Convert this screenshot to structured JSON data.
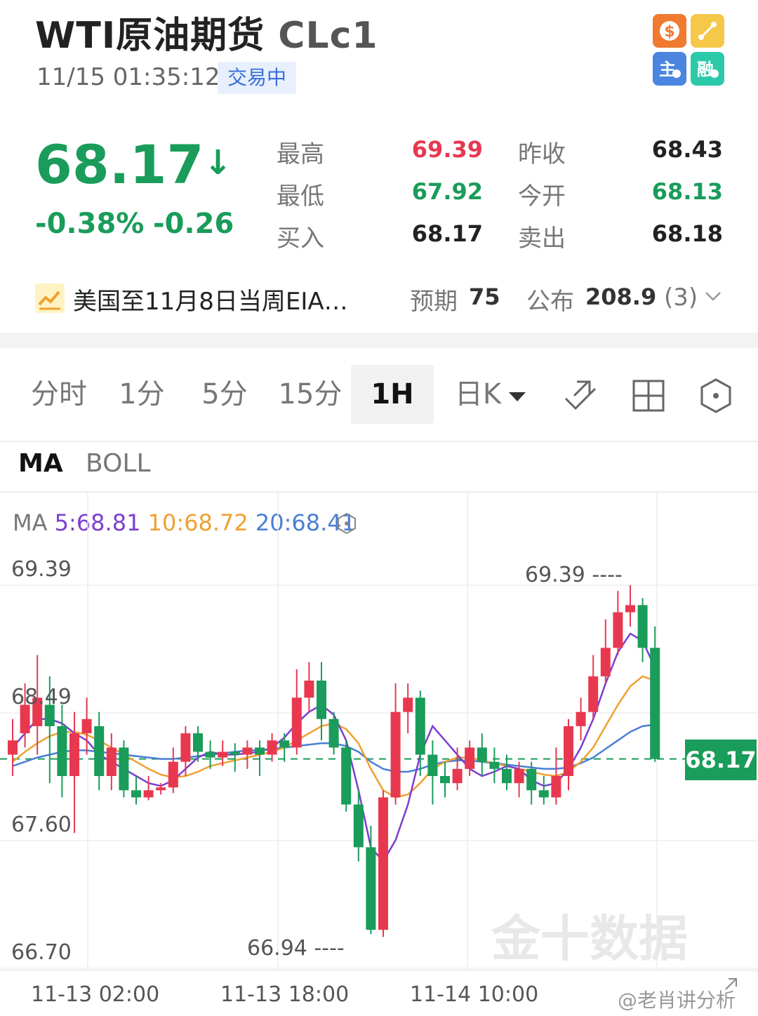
{
  "header": {
    "title": "WTI原油期货",
    "code": "CLc1",
    "time": "11/15 01:35:12",
    "status": "交易中"
  },
  "header_icons": [
    "dollar-icon",
    "link-icon",
    "main-icon",
    "finance-icon"
  ],
  "quote": {
    "price": "68.17",
    "pct": "-0.38%",
    "change": "-0.26",
    "high_label": "最高",
    "high": "69.39",
    "prev_label": "昨收",
    "prev": "68.43",
    "low_label": "最低",
    "low": "67.92",
    "open_label": "今开",
    "open": "68.13",
    "bid_label": "买入",
    "bid": "68.17",
    "ask_label": "卖出",
    "ask": "68.18"
  },
  "news": {
    "text": "美国至11月8日当周EIA…",
    "expect_label": "预期",
    "expect": "75",
    "actual_label": "公布",
    "actual": "208.9",
    "count": "(3)"
  },
  "tabs": [
    "分时",
    "1分",
    "5分",
    "15分",
    "1H",
    "日K"
  ],
  "active_tab": "1H",
  "indicator_tabs": [
    "MA",
    "BOLL"
  ],
  "ma_legend": {
    "prefix": "MA",
    "ma5": "5:68.81",
    "ma10": "10:68.72",
    "ma20": "20:68.41"
  },
  "colors": {
    "up": "#e8384f",
    "down": "#1a9c5a",
    "ma5": "#7b3fd0",
    "ma10": "#f0a030",
    "ma20": "#4a7fd4"
  },
  "chart_data": {
    "type": "candlestick",
    "y_ticks": [
      "69.39",
      "68.49",
      "67.60",
      "66.70"
    ],
    "ylim": [
      66.7,
      69.39
    ],
    "x_ticks": [
      "11-13 02:00",
      "11-13 18:00",
      "11-14 10:00"
    ],
    "high_marker": "69.39",
    "low_marker": "66.94",
    "current_price": "68.17",
    "candles": [
      [
        68.2,
        68.3,
        68.45,
        68.05
      ],
      [
        68.35,
        68.55,
        68.7,
        68.25
      ],
      [
        68.4,
        68.6,
        68.9,
        68.2
      ],
      [
        68.55,
        68.4,
        68.75,
        68.0
      ],
      [
        68.4,
        68.05,
        68.55,
        67.9
      ],
      [
        68.05,
        68.35,
        68.5,
        67.65
      ],
      [
        68.35,
        68.45,
        68.6,
        68.2
      ],
      [
        68.4,
        68.05,
        68.5,
        67.95
      ],
      [
        68.05,
        68.25,
        68.35,
        67.95
      ],
      [
        68.25,
        67.95,
        68.3,
        67.9
      ],
      [
        67.95,
        67.9,
        68.05,
        67.85
      ],
      [
        67.9,
        67.95,
        68.05,
        67.88
      ],
      [
        67.95,
        67.97,
        68.0,
        67.92
      ],
      [
        67.97,
        68.15,
        68.25,
        67.93
      ],
      [
        68.15,
        68.35,
        68.4,
        68.05
      ],
      [
        68.35,
        68.22,
        68.4,
        68.15
      ],
      [
        68.22,
        68.18,
        68.3,
        68.1
      ],
      [
        68.18,
        68.22,
        68.3,
        68.12
      ],
      [
        68.22,
        68.2,
        68.28,
        68.08
      ],
      [
        68.2,
        68.25,
        68.3,
        68.1
      ],
      [
        68.25,
        68.2,
        68.3,
        68.05
      ],
      [
        68.2,
        68.3,
        68.35,
        68.15
      ],
      [
        68.3,
        68.25,
        68.35,
        68.15
      ],
      [
        68.25,
        68.6,
        68.8,
        68.2
      ],
      [
        68.6,
        68.72,
        68.85,
        68.5
      ],
      [
        68.72,
        68.45,
        68.85,
        68.3
      ],
      [
        68.45,
        68.25,
        68.5,
        68.2
      ],
      [
        68.25,
        67.85,
        68.3,
        67.8
      ],
      [
        67.85,
        67.55,
        67.95,
        67.45
      ],
      [
        67.55,
        66.97,
        67.7,
        66.94
      ],
      [
        66.97,
        67.9,
        67.95,
        66.92
      ],
      [
        67.9,
        68.5,
        68.7,
        67.85
      ],
      [
        68.5,
        68.6,
        68.7,
        68.35
      ],
      [
        68.6,
        68.2,
        68.65,
        68.05
      ],
      [
        68.2,
        68.05,
        68.3,
        67.85
      ],
      [
        68.05,
        68.0,
        68.15,
        67.9
      ],
      [
        68.0,
        68.1,
        68.25,
        67.95
      ],
      [
        68.1,
        68.25,
        68.3,
        68.05
      ],
      [
        68.25,
        68.15,
        68.35,
        68.05
      ],
      [
        68.15,
        68.1,
        68.25,
        68.0
      ],
      [
        68.1,
        68.0,
        68.2,
        67.95
      ],
      [
        68.0,
        68.1,
        68.15,
        67.9
      ],
      [
        68.1,
        67.95,
        68.15,
        67.85
      ],
      [
        67.95,
        67.9,
        68.05,
        67.85
      ],
      [
        67.9,
        68.05,
        68.25,
        67.85
      ],
      [
        68.05,
        68.4,
        68.45,
        67.95
      ],
      [
        68.4,
        68.5,
        68.6,
        68.3
      ],
      [
        68.5,
        68.75,
        68.9,
        68.45
      ],
      [
        68.75,
        68.95,
        69.15,
        68.7
      ],
      [
        68.95,
        69.2,
        69.35,
        68.9
      ],
      [
        69.2,
        69.25,
        69.39,
        69.1
      ],
      [
        69.25,
        68.95,
        69.3,
        68.85
      ],
      [
        68.95,
        68.17,
        69.1,
        68.15
      ]
    ],
    "ma5": [
      68.25,
      68.35,
      68.45,
      68.45,
      68.42,
      68.35,
      68.3,
      68.2,
      68.15,
      68.1,
      68.05,
      68.0,
      67.98,
      68.02,
      68.1,
      68.18,
      68.22,
      68.2,
      68.2,
      68.21,
      68.22,
      68.25,
      68.32,
      68.42,
      68.5,
      68.55,
      68.48,
      68.3,
      67.95,
      67.55,
      67.45,
      67.6,
      67.85,
      68.2,
      68.4,
      68.3,
      68.2,
      68.1,
      68.05,
      68.08,
      68.12,
      68.1,
      68.02,
      67.98,
      68.0,
      68.1,
      68.25,
      68.45,
      68.7,
      68.92,
      69.05,
      69.0,
      68.81
    ],
    "ma10": [
      68.15,
      68.22,
      68.28,
      68.33,
      68.36,
      68.36,
      68.34,
      68.3,
      68.25,
      68.2,
      68.15,
      68.1,
      68.06,
      68.04,
      68.05,
      68.08,
      68.12,
      68.14,
      68.16,
      68.18,
      68.2,
      68.22,
      68.25,
      68.3,
      68.35,
      68.4,
      68.42,
      68.38,
      68.28,
      68.1,
      67.95,
      67.9,
      67.92,
      68.0,
      68.1,
      68.15,
      68.18,
      68.18,
      68.16,
      68.14,
      68.12,
      68.1,
      68.08,
      68.06,
      68.05,
      68.08,
      68.15,
      68.25,
      68.4,
      68.55,
      68.68,
      68.75,
      68.72
    ],
    "ma20": [
      68.12,
      68.15,
      68.18,
      68.2,
      68.22,
      68.23,
      68.23,
      68.22,
      68.21,
      68.2,
      68.19,
      68.18,
      68.17,
      68.17,
      68.18,
      68.19,
      68.2,
      68.21,
      68.22,
      68.23,
      68.23,
      68.24,
      68.25,
      68.26,
      68.27,
      68.28,
      68.28,
      68.26,
      68.22,
      68.15,
      68.1,
      68.08,
      68.08,
      68.1,
      68.13,
      68.15,
      68.16,
      68.16,
      68.15,
      68.14,
      68.13,
      68.12,
      68.11,
      68.1,
      68.1,
      68.11,
      68.14,
      68.18,
      68.24,
      68.3,
      68.36,
      68.4,
      68.41
    ]
  },
  "watermark": "金十数据",
  "footer_credit": "@老肖讲分析"
}
